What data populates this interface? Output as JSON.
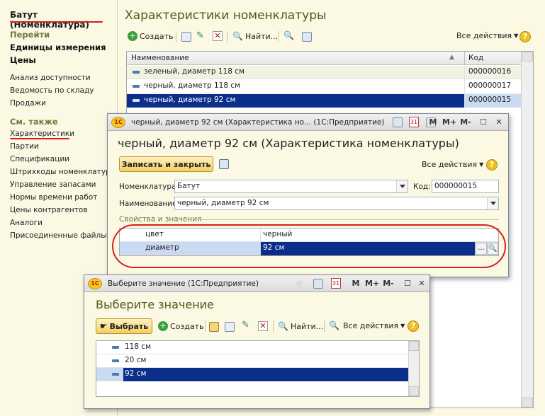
{
  "left_panel": {
    "title": "Батут (Номенклатура)",
    "goto_header": "Перейти",
    "goto_items": [
      "Единицы измерения",
      "Цены"
    ],
    "reports": [
      "Анализ доступности",
      "Ведомость по складу",
      "Продажи"
    ],
    "see_also_header": "См. также",
    "see_also_items": [
      "Характеристики",
      "Партии",
      "Спецификации",
      "Штрихкоды номенклатуры",
      "Управление запасами",
      "Нормы времени работ",
      "Цены контрагентов",
      "Аналоги",
      "Присоединенные файлы"
    ]
  },
  "main": {
    "title": "Характеристики номенклатуры",
    "toolbar": {
      "create": "Создать",
      "find": "Найти...",
      "all_actions": "Все действия",
      "help": "?"
    },
    "columns": {
      "name": "Наименование",
      "code": "Код"
    },
    "rows": [
      {
        "name": "зеленый, диаметр 118 см",
        "code": "000000016"
      },
      {
        "name": "черный, диаметр 118 см",
        "code": "000000017"
      },
      {
        "name": "черный, диаметр 92 см",
        "code": "000000015"
      }
    ]
  },
  "char_dialog": {
    "window_title": "черный, диаметр 92 см (Характеристика но...  (1С:Предприятие)",
    "heading": "черный, диаметр 92 см (Характеристика номенклатуры)",
    "save_close": "Записать и закрыть",
    "all_actions": "Все действия",
    "nomenclature_label": "Номенклатура:",
    "nomenclature_value": "Батут",
    "code_label": "Код:",
    "code_value": "000000015",
    "name_label": "Наименование:",
    "name_value": "черный, диаметр 92 см",
    "props_header": "Свойства и значения",
    "props": [
      {
        "name": "цвет",
        "value": "черный"
      },
      {
        "name": "диаметр",
        "value": "92 см"
      }
    ],
    "titlebar_buttons": {
      "m": "M",
      "mplus": "M+",
      "mminus": "M-",
      "cal": "31"
    }
  },
  "select_dialog": {
    "window_title": "Выберите значение  (1С:Предприятие)",
    "heading": "Выберите значение",
    "select_btn": "Выбрать",
    "create": "Создать",
    "find": "Найти...",
    "all_actions": "Все действия",
    "items": [
      "118 см",
      "20 см",
      "92 см"
    ],
    "titlebar_buttons": {
      "m": "M",
      "mplus": "M+",
      "mminus": "M-",
      "cal": "31"
    }
  },
  "colors": {
    "accent_red": "#d42020",
    "selection": "#0a2e8a",
    "panel_bg": "#fbf8e4"
  }
}
